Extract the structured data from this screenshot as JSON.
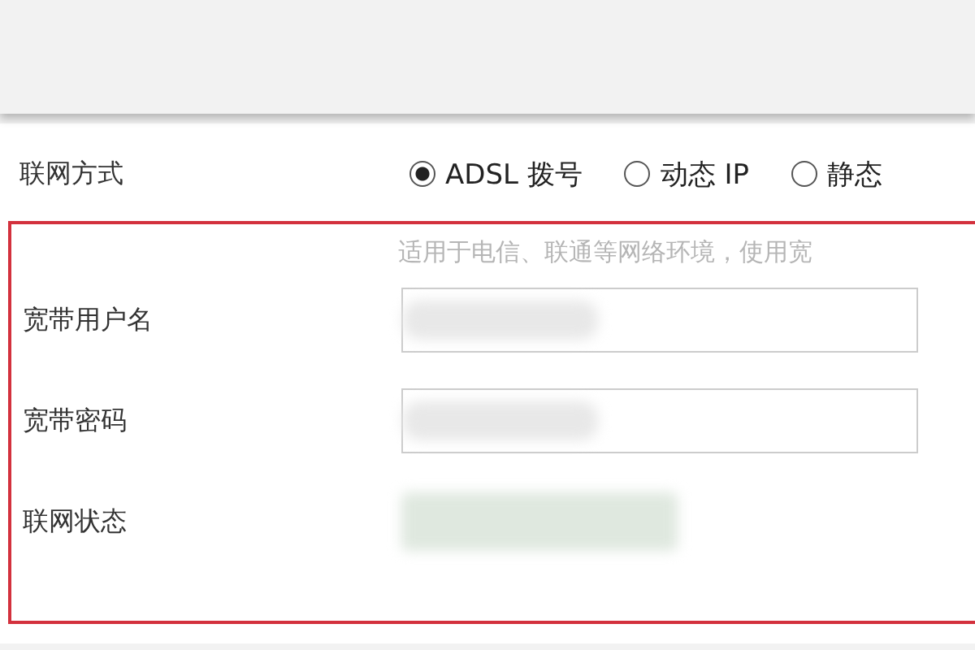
{
  "connection_type": {
    "label": "联网方式",
    "options": [
      {
        "label": "ADSL 拨号",
        "selected": true
      },
      {
        "label": "动态 IP",
        "selected": false
      },
      {
        "label": "静态",
        "selected": false
      }
    ]
  },
  "hint": "适用于电信、联通等网络环境，使用宽",
  "fields": [
    {
      "label": "宽带用户名",
      "kind": "input"
    },
    {
      "label": "宽带密码",
      "kind": "input"
    },
    {
      "label": "联网状态",
      "kind": "status"
    }
  ]
}
